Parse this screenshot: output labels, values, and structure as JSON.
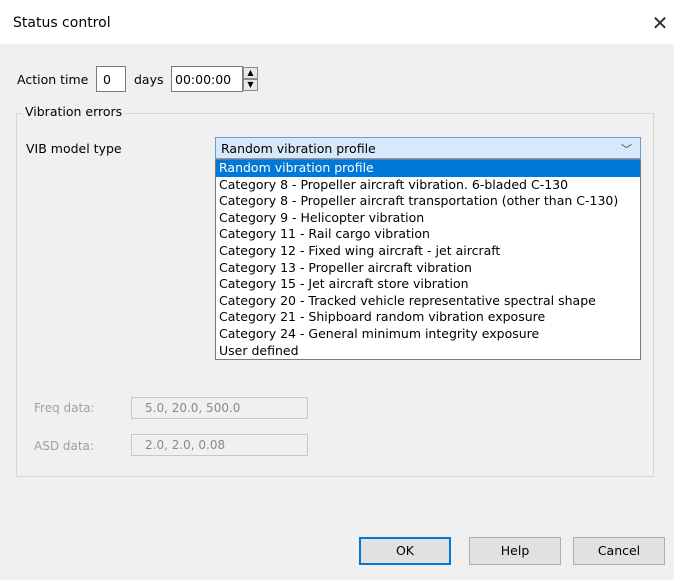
{
  "window": {
    "title": "Status control",
    "close_glyph": "✕"
  },
  "action": {
    "label": "Action time",
    "days_value": "0",
    "days_label": "days",
    "time_value": "00:00:00"
  },
  "vibration": {
    "group_title": "Vibration errors",
    "model_label": "VIB model type",
    "selected": "Random vibration profile",
    "options": [
      "Random vibration profile",
      "Category 8 - Propeller aircraft vibration. 6-bladed C-130",
      "Category 8 - Propeller aircraft transportation (other than C-130)",
      "Category 9 - Helicopter  vibration",
      "Category 11 - Rail cargo  vibration",
      "Category 12 - Fixed wing aircraft - jet aircraft",
      "Category 13 - Propeller aircraft vibration",
      "Category 15 - Jet aircraft store vibration",
      "Category 20 - Tracked vehicle representative spectral shape",
      "Category 21 - Shipboard random vibration exposure",
      "Category 24 - General minimum integrity exposure",
      "User defined"
    ],
    "freq_label": "Freq data:",
    "freq_value": "5.0, 20.0, 500.0",
    "asd_label": "ASD data:",
    "asd_value": "2.0, 2.0, 0.08"
  },
  "buttons": {
    "ok": "OK",
    "help": "Help",
    "cancel": "Cancel"
  }
}
